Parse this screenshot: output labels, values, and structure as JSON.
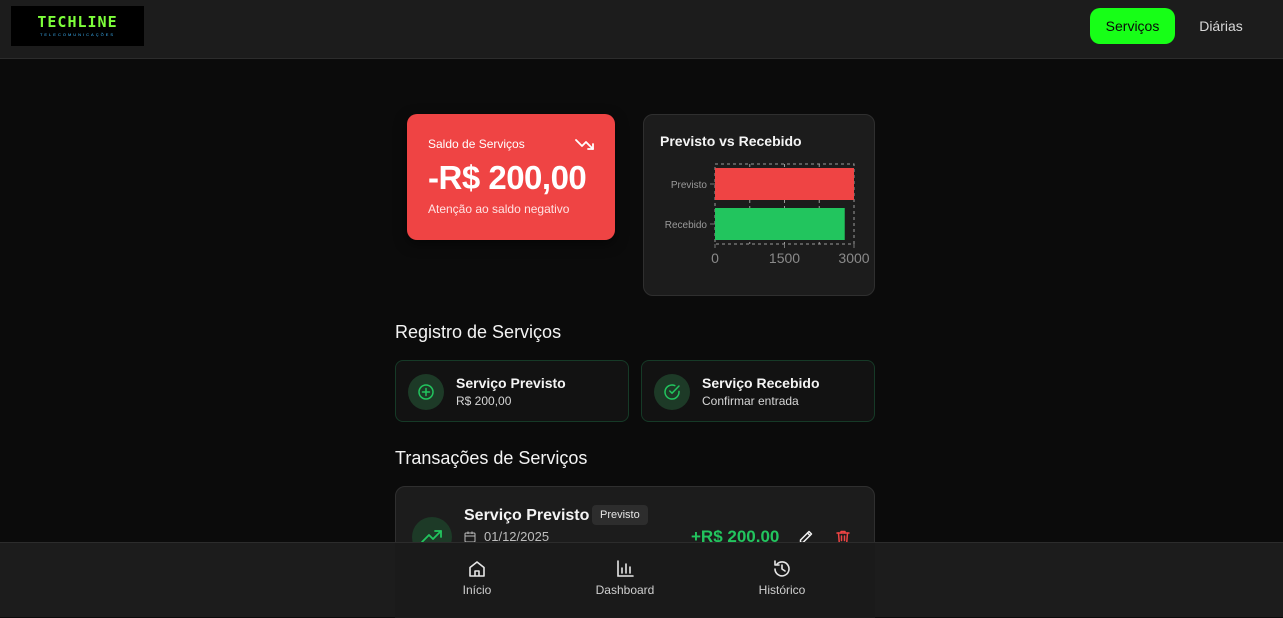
{
  "brand": {
    "logo_main": "TECHLINE",
    "logo_sub": "TELECOMUNICAÇÕES"
  },
  "nav": {
    "servicos": "Serviços",
    "diarias": "Diárias",
    "active": "Serviços",
    "active_color": "#17ff17"
  },
  "balance": {
    "label": "Saldo de Serviços",
    "value": "-R$ 200,00",
    "note": "Atenção ao saldo negativo",
    "icon": "trending-down-icon",
    "color": "#ef4444"
  },
  "chart_data": {
    "type": "bar",
    "orientation": "horizontal",
    "title": "Previsto vs Recebido",
    "categories": [
      "Previsto",
      "Recebido"
    ],
    "values": [
      3000,
      2800
    ],
    "colors": [
      "#ef4444",
      "#22c55e"
    ],
    "xlim": [
      0,
      3000
    ],
    "xticks": [
      "0",
      "1500",
      "3000"
    ],
    "grid": true
  },
  "register": {
    "title": "Registro de Serviços",
    "previsto": {
      "title": "Serviço Previsto",
      "sub": "R$ 200,00",
      "icon": "plus-circle-icon"
    },
    "recebido": {
      "title": "Serviço Recebido",
      "sub": "Confirmar entrada",
      "icon": "check-circle-icon"
    }
  },
  "transactions": {
    "title": "Transações de Serviços",
    "items": [
      {
        "title": "Serviço Previsto",
        "badge": "Previsto",
        "date": "01/12/2025",
        "amount": "+R$ 200,00",
        "icon": "trending-up-icon"
      }
    ]
  },
  "bottom_nav": {
    "inicio": "Início",
    "dashboard": "Dashboard",
    "historico": "Histórico"
  }
}
